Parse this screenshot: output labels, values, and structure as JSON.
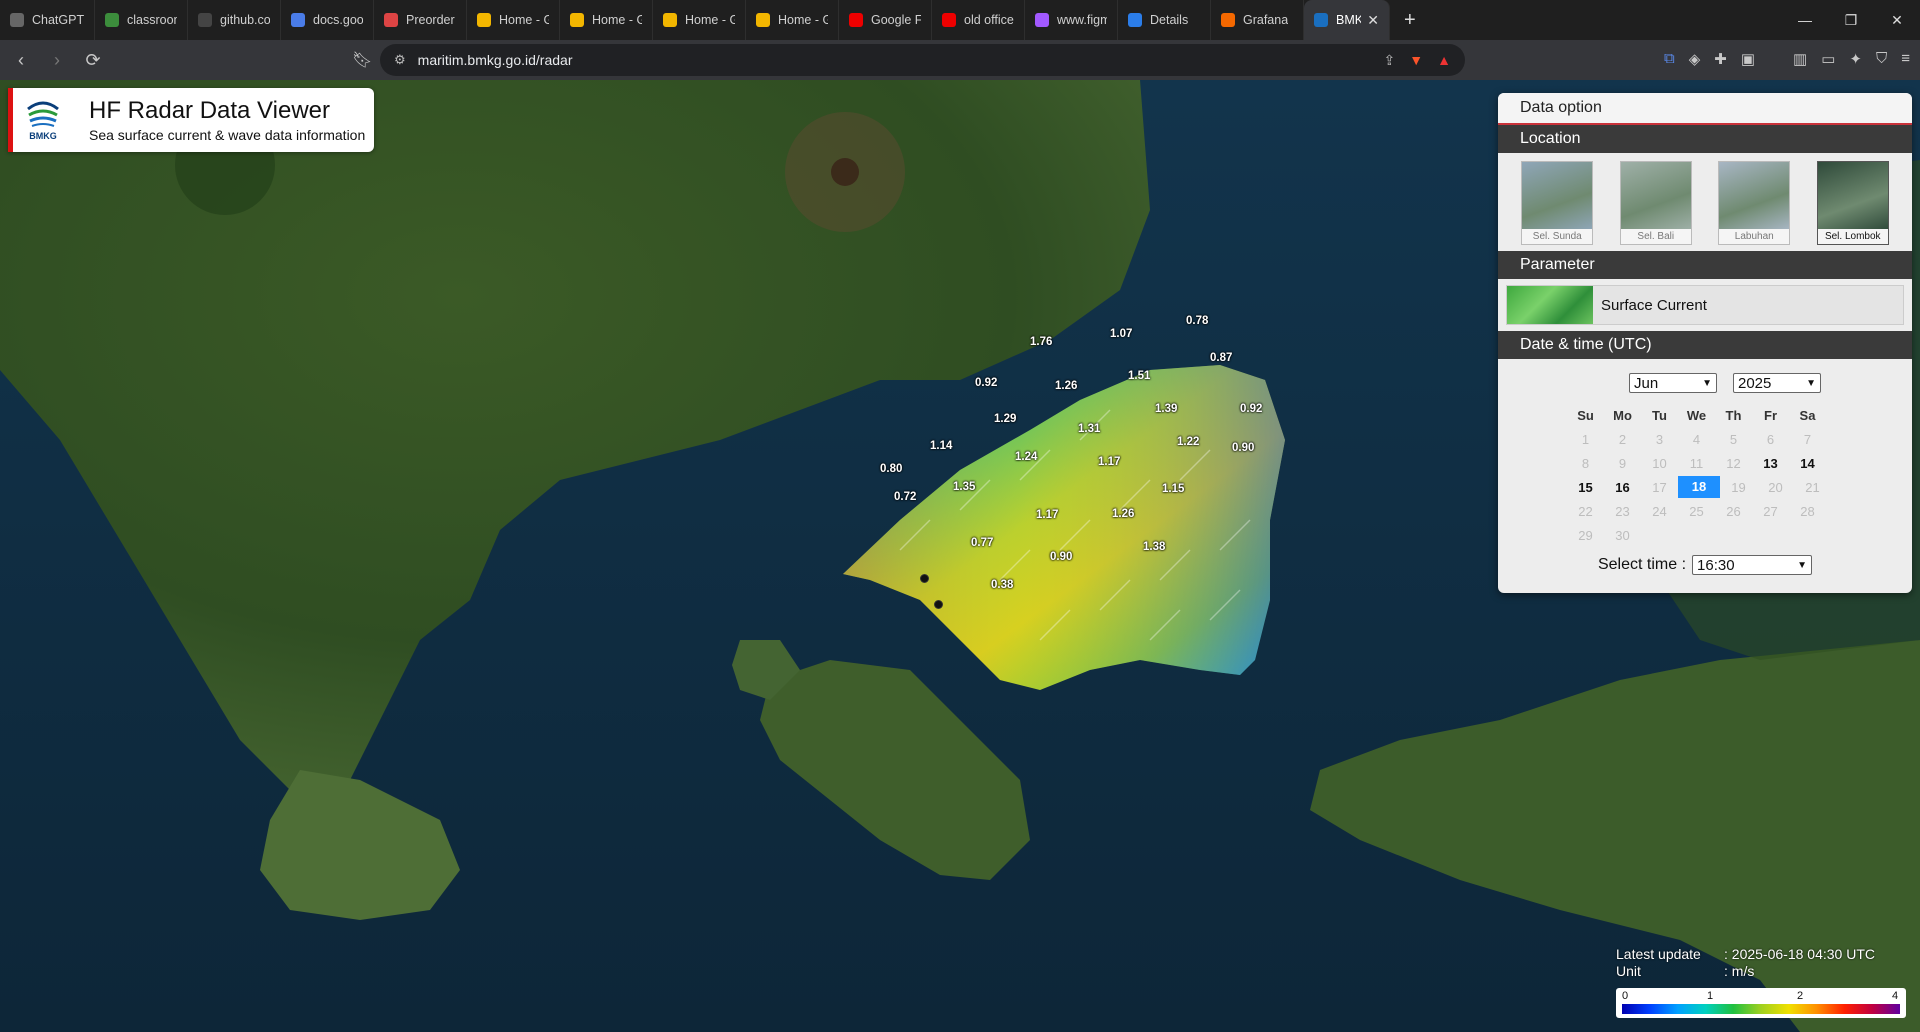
{
  "browser": {
    "tabs": [
      {
        "label": "ChatGPT",
        "icon": "chatgpt-icon"
      },
      {
        "label": "classroom.g",
        "icon": "classroom-icon"
      },
      {
        "label": "github.com",
        "icon": "github-icon"
      },
      {
        "label": "docs.google",
        "icon": "docs-icon"
      },
      {
        "label": "Preorder Ce",
        "icon": "gmail-icon"
      },
      {
        "label": "Home - Goo",
        "icon": "drive-icon"
      },
      {
        "label": "Home - Goo",
        "icon": "drive-icon"
      },
      {
        "label": "Home - Goo",
        "icon": "drive-icon"
      },
      {
        "label": "Home - Goo",
        "icon": "drive-icon"
      },
      {
        "label": "Google Fire",
        "icon": "youtube-icon"
      },
      {
        "label": "old office -",
        "icon": "youtube-icon"
      },
      {
        "label": "www.figma.",
        "icon": "figma-icon"
      },
      {
        "label": "Details",
        "icon": "details-icon"
      },
      {
        "label": "Grafana",
        "icon": "grafana-icon"
      },
      {
        "label": "BMKG |",
        "icon": "bmkg-icon",
        "active": true
      }
    ],
    "url": "maritim.bmkg.go.id/radar"
  },
  "header": {
    "logo_text": "BMKG",
    "title": "HF Radar Data Viewer",
    "subtitle": "Sea surface current & wave data information"
  },
  "panel": {
    "title": "Data option",
    "location_heading": "Location",
    "locations": [
      {
        "name": "Sel. Sunda",
        "selected": false
      },
      {
        "name": "Sel. Bali",
        "selected": false
      },
      {
        "name": "Labuhan",
        "selected": false
      },
      {
        "name": "Sel. Lombok",
        "selected": true
      }
    ],
    "parameter_heading": "Parameter",
    "parameter": "Surface Current",
    "datetime_heading": "Date & time (UTC)",
    "month": "Jun",
    "year": "2025",
    "weekdays": [
      "Su",
      "Mo",
      "Tu",
      "We",
      "Th",
      "Fr",
      "Sa"
    ],
    "weeks": [
      [
        "1",
        "2",
        "3",
        "4",
        "5",
        "6",
        "7"
      ],
      [
        "8",
        "9",
        "10",
        "11",
        "12",
        "13",
        "14"
      ],
      [
        "15",
        "16",
        "17",
        "18",
        "19",
        "20",
        "21"
      ],
      [
        "22",
        "23",
        "24",
        "25",
        "26",
        "27",
        "28"
      ],
      [
        "29",
        "30",
        "",
        "",
        "",
        "",
        ""
      ]
    ],
    "available_days": [
      "13",
      "14",
      "15",
      "16"
    ],
    "selected_day": "18",
    "select_time_label": "Select time :",
    "time": "16:30"
  },
  "legend": {
    "latest_update_label": "Latest update",
    "latest_update_value": ": 2025-06-18 04:30 UTC",
    "unit_label": "Unit",
    "unit_value": ": m/s",
    "ticks": [
      "0",
      "1",
      "2",
      "4"
    ]
  },
  "current_values": [
    "1.76",
    "1.07",
    "0.78",
    "0.87",
    "0.92",
    "1.26",
    "1.51",
    "1.29",
    "1.39",
    "0.92",
    "1.31",
    "1.14",
    "1.24",
    "1.22",
    "0.90",
    "0.80",
    "1.35",
    "1.17",
    "1.15",
    "0.72",
    "1.17",
    "1.26",
    "0.77",
    "0.90",
    "1.38",
    "0.38"
  ]
}
